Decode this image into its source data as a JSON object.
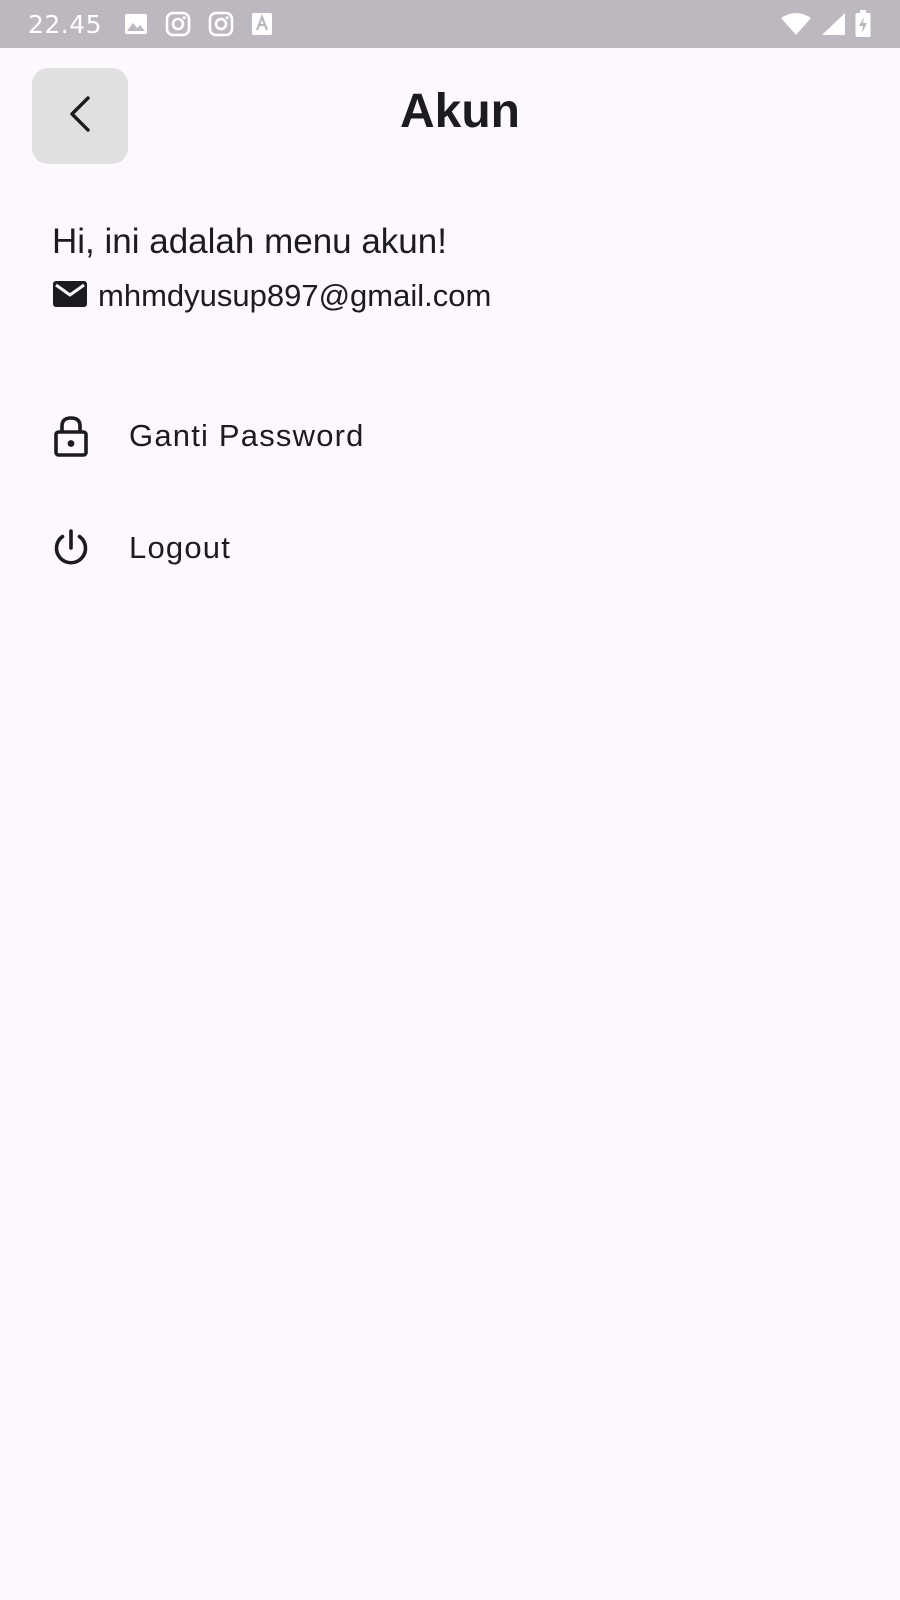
{
  "status_bar": {
    "time": "22.45",
    "left_icons": [
      "image-icon",
      "instagram-icon",
      "instagram-icon",
      "font-icon"
    ],
    "right_icons": [
      "wifi-icon",
      "signal-icon",
      "battery-charging-icon"
    ]
  },
  "app_bar": {
    "back_icon": "chevron-left-icon",
    "title": "Akun"
  },
  "account": {
    "greeting": "Hi, ini adalah menu akun!",
    "email_icon": "mail-icon",
    "email": "mhmdyusup897@gmail.com"
  },
  "menu": {
    "items": [
      {
        "icon": "lock-icon",
        "label": "Ganti Password"
      },
      {
        "icon": "power-icon",
        "label": "Logout"
      }
    ]
  },
  "colors": {
    "background": "#fdf7fe",
    "status_bar": "#bdb8bf",
    "back_button_bg": "#e0e0e0",
    "text": "#1c1b1f"
  }
}
